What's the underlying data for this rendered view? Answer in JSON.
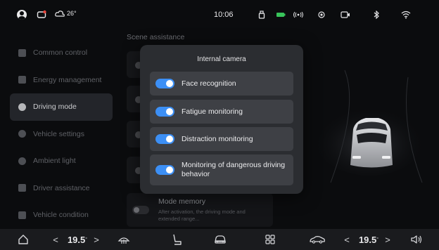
{
  "status_bar": {
    "temperature": "26°",
    "time": "10:06",
    "icons": [
      "user-avatar-icon",
      "message-icon",
      "weather-icon",
      "usb-icon",
      "battery-icon",
      "wireless-broadcast-icon",
      "location-icon",
      "dashcam-icon",
      "bluetooth-icon",
      "wifi-icon"
    ]
  },
  "sidebar": {
    "items": [
      {
        "label": "Common control",
        "icon": "grid-icon"
      },
      {
        "label": "Energy management",
        "icon": "energy-icon"
      },
      {
        "label": "Driving mode",
        "icon": "steering-icon",
        "active": true
      },
      {
        "label": "Vehicle settings",
        "icon": "gear-icon"
      },
      {
        "label": "Ambient light",
        "icon": "light-icon"
      },
      {
        "label": "Driver assistance",
        "icon": "car-icon"
      },
      {
        "label": "Vehicle condition",
        "icon": "chart-icon"
      }
    ]
  },
  "main": {
    "section_label": "Scene assistance",
    "mode_memory": {
      "title": "Mode memory",
      "description": "After activation, the driving mode and extended range..."
    }
  },
  "modal": {
    "title": "Internal camera",
    "options": [
      {
        "label": "Face recognition",
        "enabled": true
      },
      {
        "label": "Fatigue monitoring",
        "enabled": true
      },
      {
        "label": "Distraction monitoring",
        "enabled": true
      },
      {
        "label": "Monitoring of dangerous driving behavior",
        "enabled": true
      }
    ]
  },
  "bottom_bar": {
    "left_temp": "19.5",
    "right_temp": "19.5",
    "degree": "°",
    "prev": "<",
    "next": ">",
    "icons": [
      "home-icon",
      "defrost-icon",
      "seat-icon",
      "car-front-icon",
      "apps-icon",
      "car-side-icon",
      "volume-icon"
    ]
  },
  "colors": {
    "accent": "#3c8ff5",
    "background": "#0b0c0e",
    "modal": "#2b2d31",
    "option": "#3e4045"
  }
}
